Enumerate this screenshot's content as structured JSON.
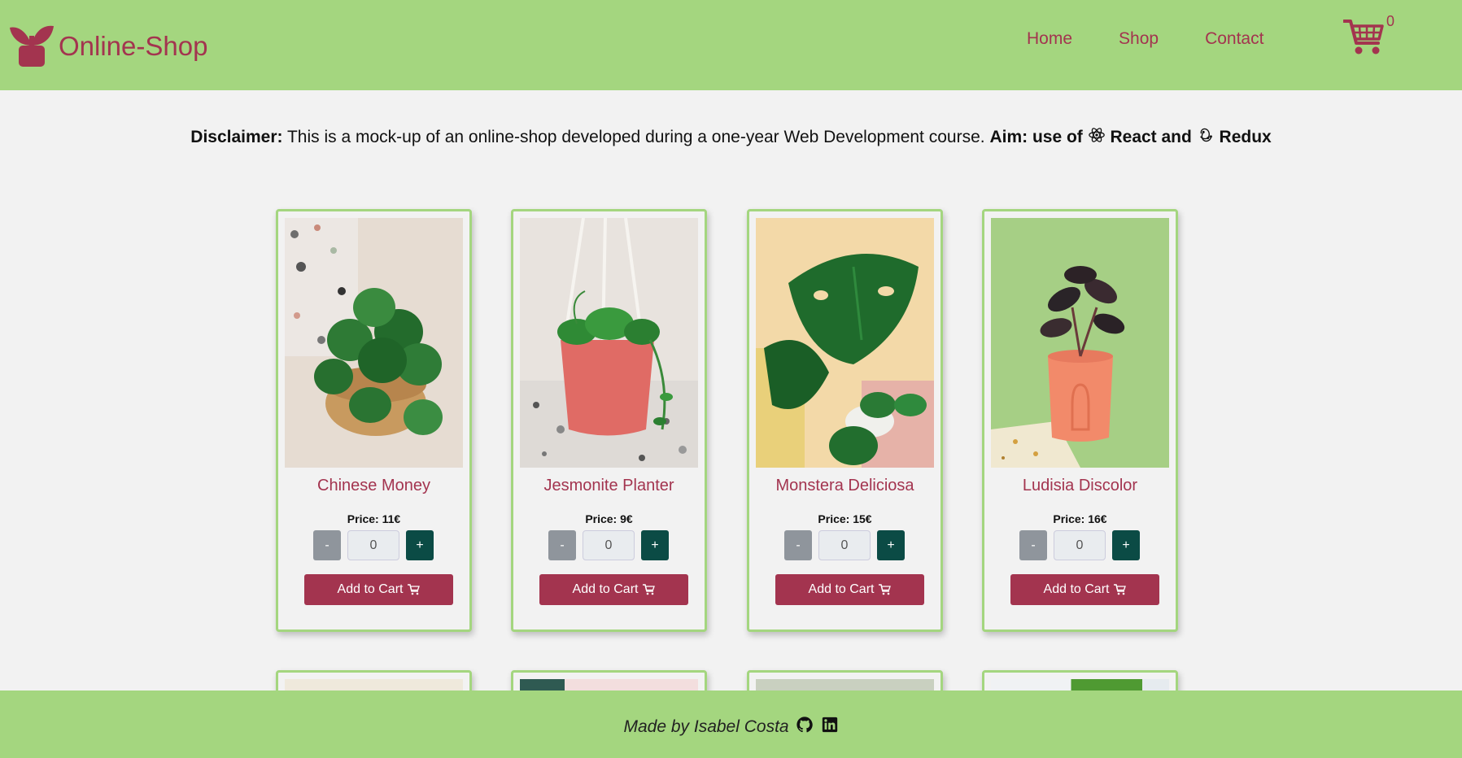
{
  "brand": {
    "name": "Online-Shop",
    "logo_icon": "plant-pot-icon"
  },
  "nav": {
    "links": [
      "Home",
      "Shop",
      "Contact"
    ],
    "cart_icon": "shopping-cart-icon",
    "cart_count": "0"
  },
  "disclaimer": {
    "label": "Disclaimer:",
    "text": "This is a mock-up of an online-shop developed during a one-year Web Development course.",
    "aim_label": "Aim: use of",
    "tech1": "React and",
    "tech2": "Redux"
  },
  "products": [
    {
      "name": "Chinese Money",
      "price": "Price: 11€",
      "quantity": "0",
      "minus": "-",
      "plus": "+",
      "add": "Add to Cart"
    },
    {
      "name": "Jesmonite Planter",
      "price": "Price: 9€",
      "quantity": "0",
      "minus": "-",
      "plus": "+",
      "add": "Add to Cart"
    },
    {
      "name": "Monstera Deliciosa",
      "price": "Price: 15€",
      "quantity": "0",
      "minus": "-",
      "plus": "+",
      "add": "Add to Cart"
    },
    {
      "name": "Ludisia Discolor",
      "price": "Price: 16€",
      "quantity": "0",
      "minus": "-",
      "plus": "+",
      "add": "Add to Cart"
    }
  ],
  "footer": {
    "text": "Made by Isabel Costa",
    "icons": [
      "github-icon",
      "linkedin-icon"
    ]
  },
  "colors": {
    "header_bg": "#a4d67f",
    "brand": "#a3344f",
    "plus_btn": "#0b4b45",
    "minus_btn": "#8f959c",
    "page_bg": "#f2f2f2"
  }
}
